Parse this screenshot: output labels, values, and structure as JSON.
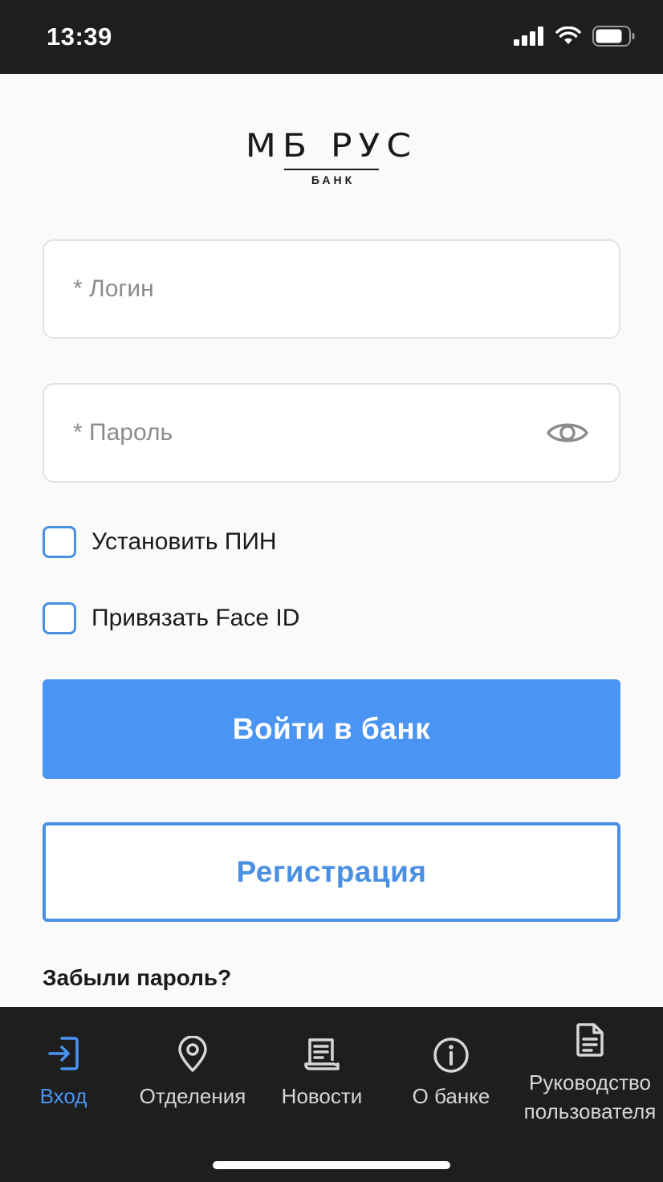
{
  "status_bar": {
    "time": "13:39"
  },
  "logo": {
    "main": "МБ РУС",
    "sub": "БАНК"
  },
  "form": {
    "login_placeholder": "* Логин",
    "login_value": "",
    "password_placeholder": "* Пароль",
    "password_value": "",
    "set_pin_label": "Установить ПИН",
    "set_pin_checked": false,
    "face_id_label": "Привязать Face ID",
    "face_id_checked": false,
    "login_button": "Войти в банк",
    "register_button": "Регистрация",
    "forgot_password": "Забыли пароль?"
  },
  "tabbar": {
    "items": [
      {
        "label": "Вход",
        "icon": "login-icon",
        "active": true
      },
      {
        "label": "Отделения",
        "icon": "map-pin-icon",
        "active": false
      },
      {
        "label": "Новости",
        "icon": "news-icon",
        "active": false
      },
      {
        "label": "О банке",
        "icon": "info-icon",
        "active": false
      },
      {
        "label_line1": "Руководство",
        "label_line2": "пользователя",
        "icon": "document-icon",
        "active": false
      }
    ]
  },
  "colors": {
    "accent": "#4a94f3",
    "accent_border": "#4a90e2",
    "dark_bar": "#1e1e1e",
    "background": "#fafafa"
  }
}
